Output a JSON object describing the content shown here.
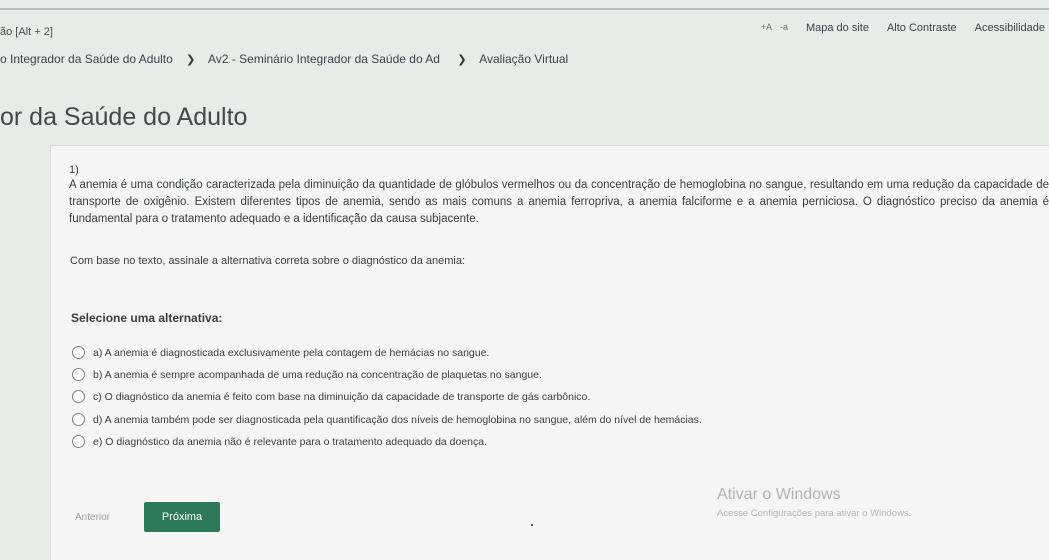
{
  "header": {
    "skip_link": "ão [Alt + 2]",
    "font_increase": "+A",
    "font_decrease": "-a",
    "sitemap": "Mapa do site",
    "high_contrast": "Alto Contraste",
    "accessibility": "Acessibilidade"
  },
  "breadcrumb": {
    "items": [
      "o Integrador da Saúde do Adulto",
      "Av2 - Seminário Integrador da Saúde do Ad",
      "Avaliação Virtual"
    ],
    "separator": "❯"
  },
  "page_title": "or da Saúde do Adulto",
  "question": {
    "number": "1)",
    "text": "A anemia é uma condição caracterizada pela diminuição da quantidade de glóbulos vermelhos ou da concentração de hemoglobina no sangue, resultando em uma redução da capacidade de transporte de oxigênio. Existem diferentes tipos de anemia, sendo as mais comuns a anemia ferropriva, a anemia falciforme e a anemia perniciosa. O diagnóstico preciso da anemia é fundamental para o tratamento adequado e a identificação da causa subjacente.",
    "prompt": "Com base no texto, assinale a alternativa correta sobre o diagnóstico da anemia:",
    "select_label": "Selecione uma alternativa:",
    "options": [
      "a) A anemia é diagnosticada exclusivamente pela contagem de hemácias no sangue.",
      "b) A anemia é sempre acompanhada de uma redução na concentração de plaquetas no sangue.",
      "c) O diagnóstico da anemia é feito com base na diminuição da capacidade de transporte de gás carbônico.",
      "d) A anemia também pode ser diagnosticada pela quantificação dos níveis de hemoglobina no sangue, além do nível de hemácias.",
      "e) O diagnóstico da anemia não é relevante para o tratamento adequado da doença."
    ]
  },
  "navigation": {
    "previous": "Anterior",
    "next": "Próxima"
  },
  "watermark": {
    "title": "Ativar o Windows",
    "subtitle": "Acesse Configurações para ativar o Windows."
  },
  "colors": {
    "next_button": "#2c7a57",
    "background": "#e9ebe9"
  }
}
